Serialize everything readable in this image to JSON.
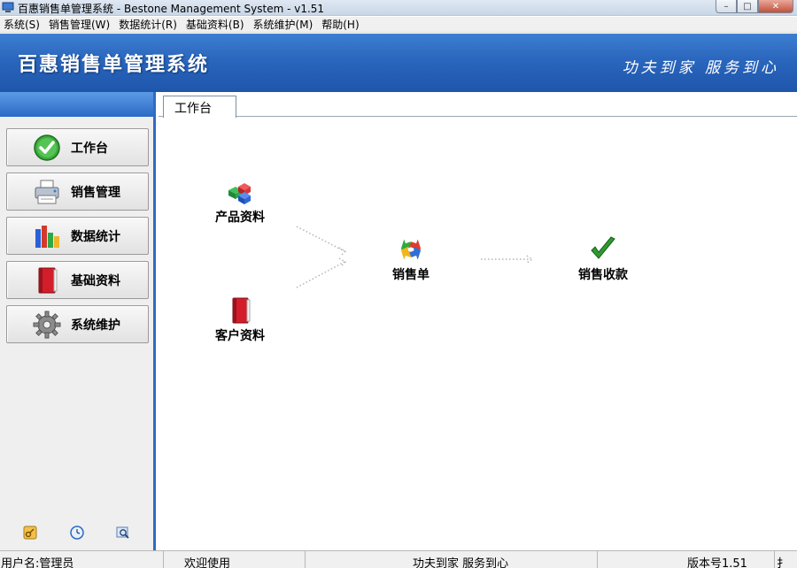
{
  "window": {
    "title": "百惠销售单管理系统 - Bestone Management System - v1.51",
    "controls": {
      "minimize": "–",
      "maximize": "□",
      "close": "✕"
    }
  },
  "menubar": {
    "items": [
      "系统(S)",
      "销售管理(W)",
      "数据统计(R)",
      "基础资料(B)",
      "系统维护(M)",
      "帮助(H)"
    ]
  },
  "banner": {
    "title": "百惠销售单管理系统",
    "slogan": "功夫到家 服务到心"
  },
  "sidebar": {
    "items": [
      {
        "label": "工作台",
        "icon": "check-circle-icon"
      },
      {
        "label": "销售管理",
        "icon": "printer-icon"
      },
      {
        "label": "数据统计",
        "icon": "bar-chart-icon"
      },
      {
        "label": "基础资料",
        "icon": "book-icon"
      },
      {
        "label": "系统维护",
        "icon": "gear-icon"
      }
    ],
    "tools": [
      "key-icon",
      "clock-icon",
      "search-icon"
    ]
  },
  "main": {
    "tab": "工作台",
    "flow": {
      "product": "产品资料",
      "customer": "客户资料",
      "sales_order": "销售单",
      "payment": "销售收款"
    }
  },
  "statusbar": {
    "user": "用户名:管理员",
    "welcome": "欢迎使用",
    "slogan": "功夫到家 服务到心",
    "version": "版本号1.51",
    "extra": "扌"
  }
}
